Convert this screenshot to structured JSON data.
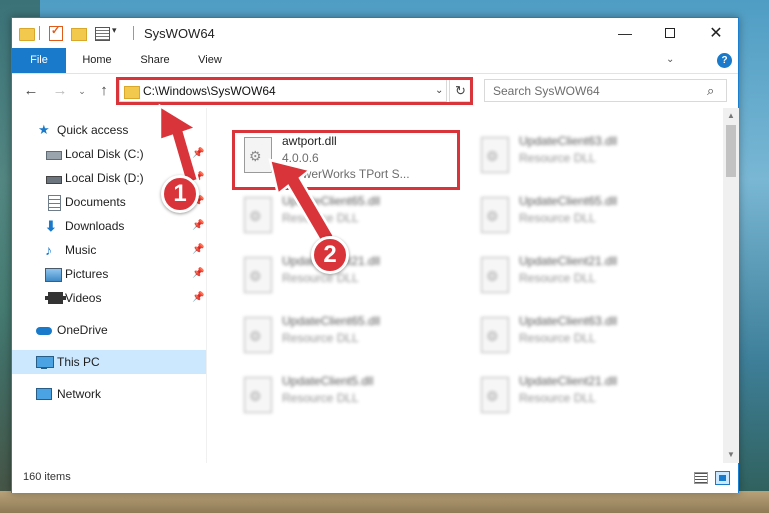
{
  "window": {
    "title": "SysWOW64",
    "ribbon_tabs": [
      "File",
      "Home",
      "Share",
      "View"
    ]
  },
  "address": {
    "path": "C:\\Windows\\SysWOW64",
    "search_placeholder": "Search SysWOW64"
  },
  "sidebar": {
    "items": [
      {
        "label": "Quick access",
        "icon": "star-icon",
        "pinned": false,
        "selected": false
      },
      {
        "label": "Local Disk (C:)",
        "icon": "drive-icon",
        "pinned": true,
        "selected": false
      },
      {
        "label": "Local Disk (D:)",
        "icon": "drive-icon",
        "pinned": true,
        "selected": false
      },
      {
        "label": "Documents",
        "icon": "documents-icon",
        "pinned": true,
        "selected": false
      },
      {
        "label": "Downloads",
        "icon": "download-icon",
        "pinned": true,
        "selected": false
      },
      {
        "label": "Music",
        "icon": "music-icon",
        "pinned": true,
        "selected": false
      },
      {
        "label": "Pictures",
        "icon": "pictures-icon",
        "pinned": true,
        "selected": false
      },
      {
        "label": "Videos",
        "icon": "videos-icon",
        "pinned": true,
        "selected": false
      },
      {
        "label": "OneDrive",
        "icon": "cloud-icon",
        "pinned": false,
        "selected": false
      },
      {
        "label": "This PC",
        "icon": "computer-icon",
        "pinned": false,
        "selected": true
      },
      {
        "label": "Network",
        "icon": "network-icon",
        "pinned": false,
        "selected": false
      }
    ]
  },
  "files": [
    {
      "name": "awtport.dll",
      "line2": "4.0.0.6",
      "line3": "AnswerWorks TPort S...",
      "highlighted": true
    },
    {
      "name": "UpdateClient63.dll",
      "line2": "Resource DLL",
      "line3": "",
      "highlighted": false
    },
    {
      "name": "UpdateClient65.dll",
      "line2": "Resource DLL",
      "line3": "",
      "highlighted": false
    },
    {
      "name": "UpdateClient65.dll",
      "line2": "Resource DLL",
      "line3": "",
      "highlighted": false
    },
    {
      "name": "UpdateClient21.dll",
      "line2": "Resource DLL",
      "line3": "",
      "highlighted": false
    },
    {
      "name": "UpdateClient21.dll",
      "line2": "Resource DLL",
      "line3": "",
      "highlighted": false
    },
    {
      "name": "UpdateClient65.dll",
      "line2": "Resource DLL",
      "line3": "",
      "highlighted": false
    },
    {
      "name": "UpdateClient63.dll",
      "line2": "Resource DLL",
      "line3": "",
      "highlighted": false
    },
    {
      "name": "UpdateClient5.dll",
      "line2": "Resource DLL",
      "line3": "",
      "highlighted": false
    },
    {
      "name": "UpdateClient21.dll",
      "line2": "Resource DLL",
      "line3": "",
      "highlighted": false
    }
  ],
  "status": {
    "item_count": "160 items"
  },
  "annotations": {
    "step1": "1",
    "step2": "2",
    "color": "#d9343a"
  }
}
